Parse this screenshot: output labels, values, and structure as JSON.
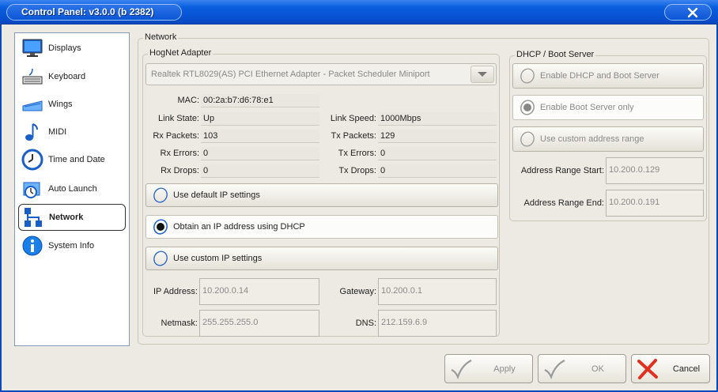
{
  "window": {
    "title": "Control Panel: v3.0.0 (b 2382)"
  },
  "sidebar": {
    "items": [
      {
        "label": "Displays",
        "icon": "monitor-icon"
      },
      {
        "label": "Keyboard",
        "icon": "keyboard-icon"
      },
      {
        "label": "Wings",
        "icon": "wings-icon"
      },
      {
        "label": "MIDI",
        "icon": "music-note-icon"
      },
      {
        "label": "Time and Date",
        "icon": "clock-icon"
      },
      {
        "label": "Auto Launch",
        "icon": "auto-launch-icon"
      },
      {
        "label": "Network",
        "icon": "network-icon",
        "active": true
      },
      {
        "label": "System Info",
        "icon": "info-icon"
      }
    ]
  },
  "network": {
    "group_title": "Network",
    "adapter_group_title": "HogNet Adapter",
    "adapter_selected": "Realtek RTL8029(AS) PCI Ethernet Adapter - Packet Scheduler Miniport",
    "stats": {
      "mac_label": "MAC:",
      "mac_value": "00:2a:b7:d6:78:e1",
      "link_state_label": "Link State:",
      "link_state_value": "Up",
      "link_speed_label": "Link Speed:",
      "link_speed_value": "1000Mbps",
      "rx_packets_label": "Rx Packets:",
      "rx_packets_value": "103",
      "tx_packets_label": "Tx Packets:",
      "tx_packets_value": "129",
      "rx_errors_label": "Rx Errors:",
      "rx_errors_value": "0",
      "tx_errors_label": "Tx Errors:",
      "tx_errors_value": "0",
      "rx_drops_label": "Rx Drops:",
      "rx_drops_value": "0",
      "tx_drops_label": "Tx Drops:",
      "tx_drops_value": "0"
    },
    "options": {
      "default_ip": "Use default IP settings",
      "dhcp": "Obtain an IP address using DHCP",
      "custom_ip": "Use custom IP settings"
    },
    "fields": {
      "ip_label": "IP Address:",
      "ip_value": "10.200.0.14",
      "gateway_label": "Gateway:",
      "gateway_value": "10.200.0.1",
      "netmask_label": "Netmask:",
      "netmask_value": "255.255.255.0",
      "dns_label": "DNS:",
      "dns_value": "212.159.6.9"
    }
  },
  "dhcp_server": {
    "group_title": "DHCP / Boot Server",
    "enable_dhcp_boot": "Enable DHCP and Boot Server",
    "enable_boot_only": "Enable Boot Server only",
    "custom_range": "Use custom address range",
    "range_start_label": "Address Range Start:",
    "range_start_value": "10.200.0.129",
    "range_end_label": "Address Range End:",
    "range_end_value": "10.200.0.191"
  },
  "buttons": {
    "apply": "Apply",
    "ok": "OK",
    "cancel": "Cancel"
  },
  "colors": {
    "titlebar": "#0a5fe0",
    "accent": "#1050c8",
    "cancel_x": "#e03020"
  }
}
